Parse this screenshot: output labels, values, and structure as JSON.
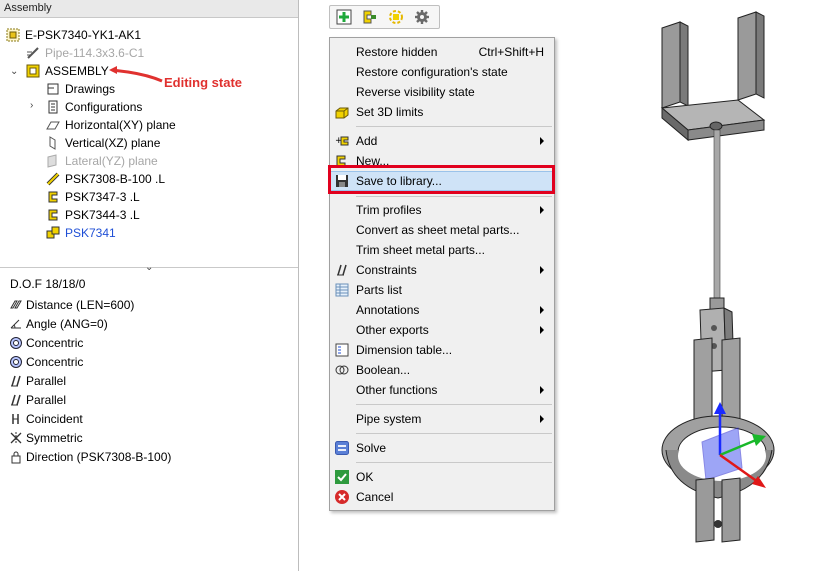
{
  "panel": {
    "title": "Assembly"
  },
  "tree": {
    "root": "E-PSK7340-YK1-AK1",
    "pipe": "Pipe-114.3x3.6-C1",
    "assembly": "ASSEMBLY",
    "drawings": "Drawings",
    "configurations": "Configurations",
    "horizontal_plane": "Horizontal(XY) plane",
    "vertical_plane": "Vertical(XZ) plane",
    "lateral_plane": "Lateral(YZ) plane",
    "part1": "PSK7308-B-100 .L",
    "part2": "PSK7347-3 .L",
    "part3": "PSK7344-3 .L",
    "part4": "PSK7341"
  },
  "annotation": {
    "editing_state": "Editing state",
    "color": "#e0312f"
  },
  "dof": {
    "header": "D.O.F  18/18/0",
    "items": [
      "Distance (LEN=600)",
      "Angle (ANG=0)",
      "Concentric",
      "Concentric",
      "Parallel",
      "Parallel",
      "Coincident",
      "Symmetric",
      "Direction (PSK7308-B-100)"
    ]
  },
  "toolbar": {
    "icons": [
      "add-green-icon",
      "assembly-icon",
      "part-icon",
      "gear-icon"
    ]
  },
  "menu": {
    "restore_hidden": "Restore hidden",
    "restore_hidden_shortcut": "Ctrl+Shift+H",
    "restore_config": "Restore configuration's state",
    "reverse_visibility": "Reverse visibility state",
    "set_3d_limits": "Set 3D limits",
    "add": "Add",
    "new": "New...",
    "save_to_library": "Save to library...",
    "trim_profiles": "Trim profiles",
    "convert_sheet": "Convert as sheet metal parts...",
    "trim_sheet": "Trim sheet metal parts...",
    "constraints": "Constraints",
    "parts_list": "Parts list",
    "annotations": "Annotations",
    "other_exports": "Other exports",
    "dimension_table": "Dimension table...",
    "boolean": "Boolean...",
    "other_functions": "Other functions",
    "pipe_system": "Pipe system",
    "solve": "Solve",
    "ok": "OK",
    "cancel": "Cancel"
  },
  "colors": {
    "highlight_box": "#e1001e",
    "link_blue": "#1f4fd6",
    "menu_bg": "#f0f0f0"
  }
}
